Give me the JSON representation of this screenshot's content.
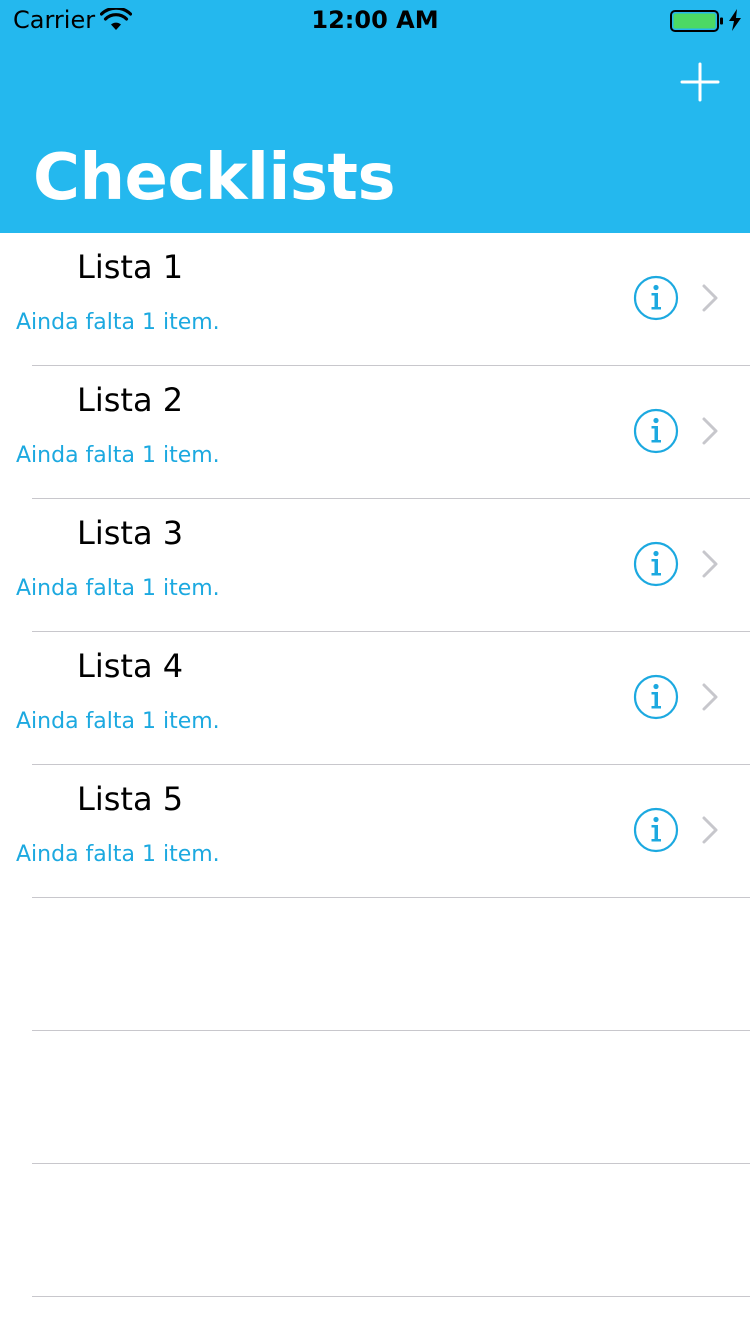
{
  "status_bar": {
    "carrier": "Carrier",
    "time": "12:00 AM",
    "battery_color": "#4cd964"
  },
  "nav": {
    "title": "Checklists",
    "add_icon": "plus-icon",
    "background_color": "#24b8ee"
  },
  "accent_color": "#1ca9e0",
  "checklists": [
    {
      "name": "Lista 1",
      "subtitle": "Ainda falta 1 item."
    },
    {
      "name": "Lista 2",
      "subtitle": "Ainda falta 1 item."
    },
    {
      "name": "Lista 3",
      "subtitle": "Ainda falta 1 item."
    },
    {
      "name": "Lista 4",
      "subtitle": "Ainda falta 1 item."
    },
    {
      "name": "Lista 5",
      "subtitle": "Ainda falta 1 item."
    }
  ]
}
